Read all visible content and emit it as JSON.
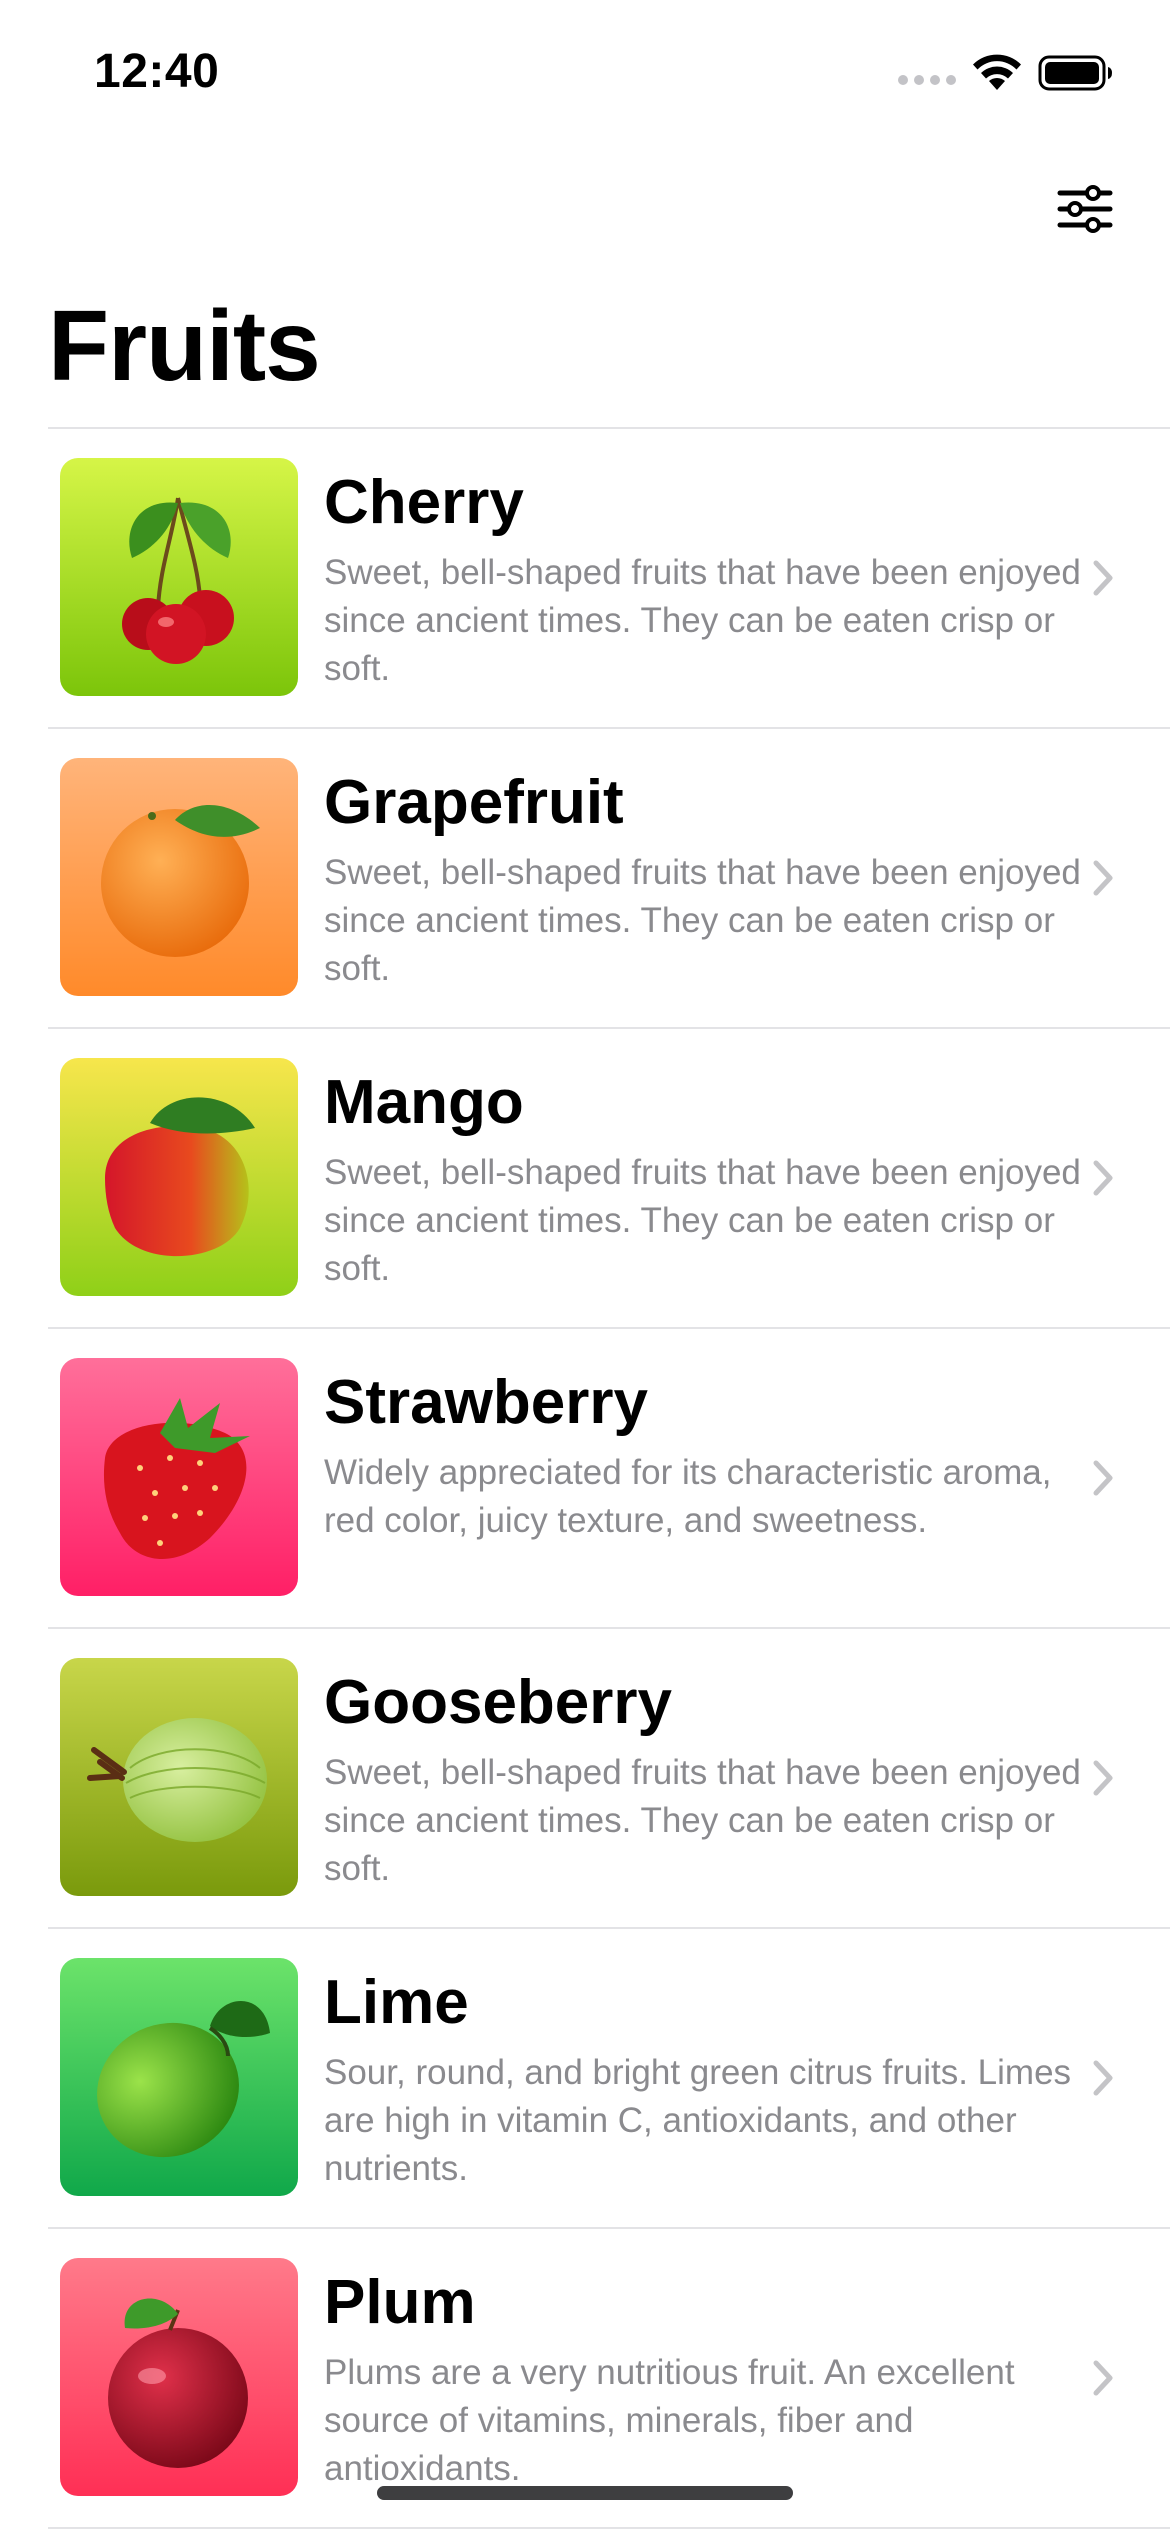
{
  "status_bar": {
    "time": "12:40",
    "icons": [
      "cellular-signal-icon",
      "wifi-icon",
      "battery-icon"
    ]
  },
  "nav": {
    "title": "Fruits",
    "filter_icon": "sliders-icon"
  },
  "colors": {
    "description_gray": "#8a8a8e",
    "separator": "#e3e3e6",
    "chevron": "#c4c4c7"
  },
  "fruits": [
    {
      "name": "Cherry",
      "description": "Sweet, bell-shaped fruits that have been enjoyed since ancient times. They can be eaten crisp or soft.",
      "gradient": [
        "#d6f547",
        "#7cc50a"
      ],
      "image": "cherry-image"
    },
    {
      "name": "Grapefruit",
      "description": "Sweet, bell-shaped fruits that have been enjoyed since ancient times. They can be eaten crisp or soft.",
      "gradient": [
        "#ffb47a",
        "#ff8a2a"
      ],
      "image": "grapefruit-image"
    },
    {
      "name": "Mango",
      "description": "Sweet, bell-shaped fruits that have been enjoyed since ancient times. They can be eaten crisp or soft.",
      "gradient": [
        "#f7e64c",
        "#8fd018"
      ],
      "image": "mango-image"
    },
    {
      "name": "Strawberry",
      "description": "Widely appreciated for its characteristic aroma,  red color, juicy texture, and sweetness.",
      "gradient": [
        "#ff6f9a",
        "#ff1f66"
      ],
      "image": "strawberry-image"
    },
    {
      "name": "Gooseberry",
      "description": "Sweet, bell-shaped fruits that have been enjoyed since ancient times. They can be eaten crisp or soft.",
      "gradient": [
        "#c8d64a",
        "#7a9a0c"
      ],
      "image": "gooseberry-image"
    },
    {
      "name": "Lime",
      "description": "Sour, round, and bright green citrus fruits. Limes are high in vitamin C, antioxidants, and other nutrients.",
      "gradient": [
        "#6ce36a",
        "#10a84a"
      ],
      "image": "lime-image"
    },
    {
      "name": "Plum",
      "description": "Plums are a very nutritious fruit. An excellent source of vitamins, minerals, fiber and antioxidants.",
      "gradient": [
        "#ff7a8a",
        "#ff2f55"
      ],
      "image": "plum-image"
    }
  ]
}
